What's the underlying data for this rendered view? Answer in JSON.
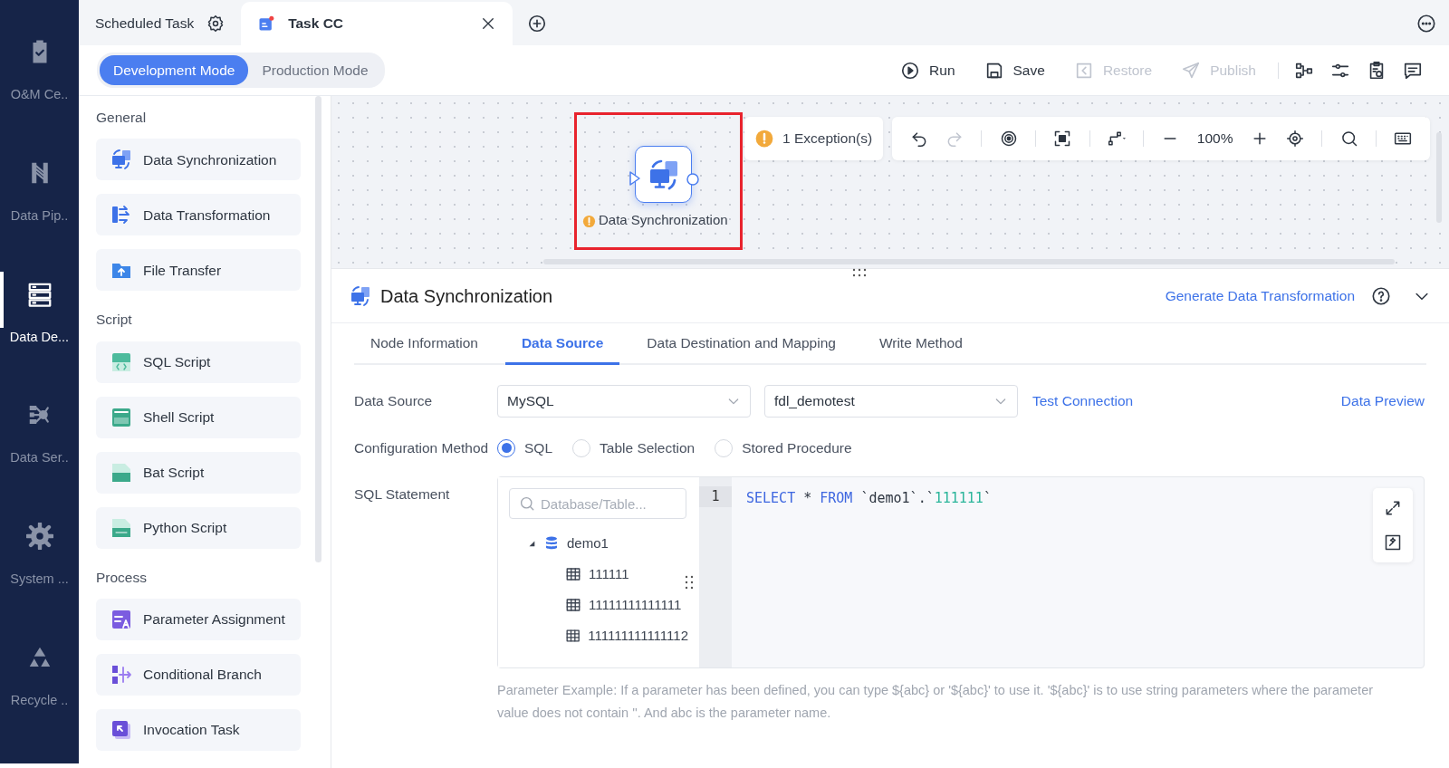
{
  "nav_items": [
    {
      "label": "O&M Ce..",
      "selected": false
    },
    {
      "label": "Data Pip..",
      "selected": false
    },
    {
      "label": "Data De...",
      "selected": true
    },
    {
      "label": "Data Ser..",
      "selected": false
    },
    {
      "label": "System ...",
      "selected": false
    },
    {
      "label": "Recycle ..",
      "selected": false
    }
  ],
  "tabs": [
    {
      "label": "Scheduled Task",
      "selected": false
    },
    {
      "label": "Task CC",
      "selected": true
    }
  ],
  "modes": [
    {
      "label": "Development Mode",
      "selected": true
    },
    {
      "label": "Production Mode",
      "selected": false
    }
  ],
  "actions": [
    {
      "label": "Run",
      "disabled": false
    },
    {
      "label": "Save",
      "disabled": false
    },
    {
      "label": "Restore",
      "disabled": true
    },
    {
      "label": "Publish",
      "disabled": true
    }
  ],
  "palette": [
    {
      "title": "General",
      "items": [
        "Data Synchronization",
        "Data Transformation",
        "File Transfer"
      ]
    },
    {
      "title": "Script",
      "items": [
        "SQL Script",
        "Shell Script",
        "Bat Script",
        "Python Script"
      ]
    },
    {
      "title": "Process",
      "items": [
        "Parameter Assignment",
        "Conditional Branch",
        "Invocation Task"
      ]
    }
  ],
  "canvas": {
    "node": {
      "label": "Data Synchronization",
      "warning": true,
      "highlighted": true
    },
    "exceptions": "1 Exception(s)",
    "zoom": "100%"
  },
  "panel": {
    "title": "Data Synchronization",
    "link": "Generate Data Transformation",
    "tabs": [
      {
        "label": "Node Information",
        "selected": false
      },
      {
        "label": "Data Source",
        "selected": true
      },
      {
        "label": "Data Destination and Mapping",
        "selected": false
      },
      {
        "label": "Write Method",
        "selected": false
      }
    ],
    "data_source": {
      "label": "Data Source",
      "type": "MySQL",
      "database": "fdl_demotest",
      "test": "Test Connection",
      "preview": "Data Preview"
    },
    "config": {
      "label": "Configuration Method",
      "options": [
        {
          "label": "SQL",
          "selected": true
        },
        {
          "label": "Table Selection",
          "selected": false
        },
        {
          "label": "Stored Procedure",
          "selected": false
        }
      ]
    },
    "sql": {
      "label": "SQL Statement",
      "search_placeholder": "Database/Table...",
      "tree": [
        {
          "label": "demo1",
          "expanded": true,
          "children": [
            {
              "label": "111111"
            },
            {
              "label": "11111111111111"
            },
            {
              "label": "111111111111112"
            }
          ]
        }
      ],
      "line_number": "1",
      "tokens": [
        {
          "text": "SELECT",
          "kind": "keyword"
        },
        {
          "text": " * ",
          "kind": "plain"
        },
        {
          "text": "FROM",
          "kind": "keyword"
        },
        {
          "text": " `demo1`.`",
          "kind": "plain"
        },
        {
          "text": "111111",
          "kind": "number"
        },
        {
          "text": "`",
          "kind": "plain"
        }
      ]
    },
    "help": "Parameter Example: If a parameter has been defined, you can type ${abc} or '${abc}' to use it. '${abc}' is to use string parameters where the parameter value does not contain ''. And abc is the parameter name."
  }
}
